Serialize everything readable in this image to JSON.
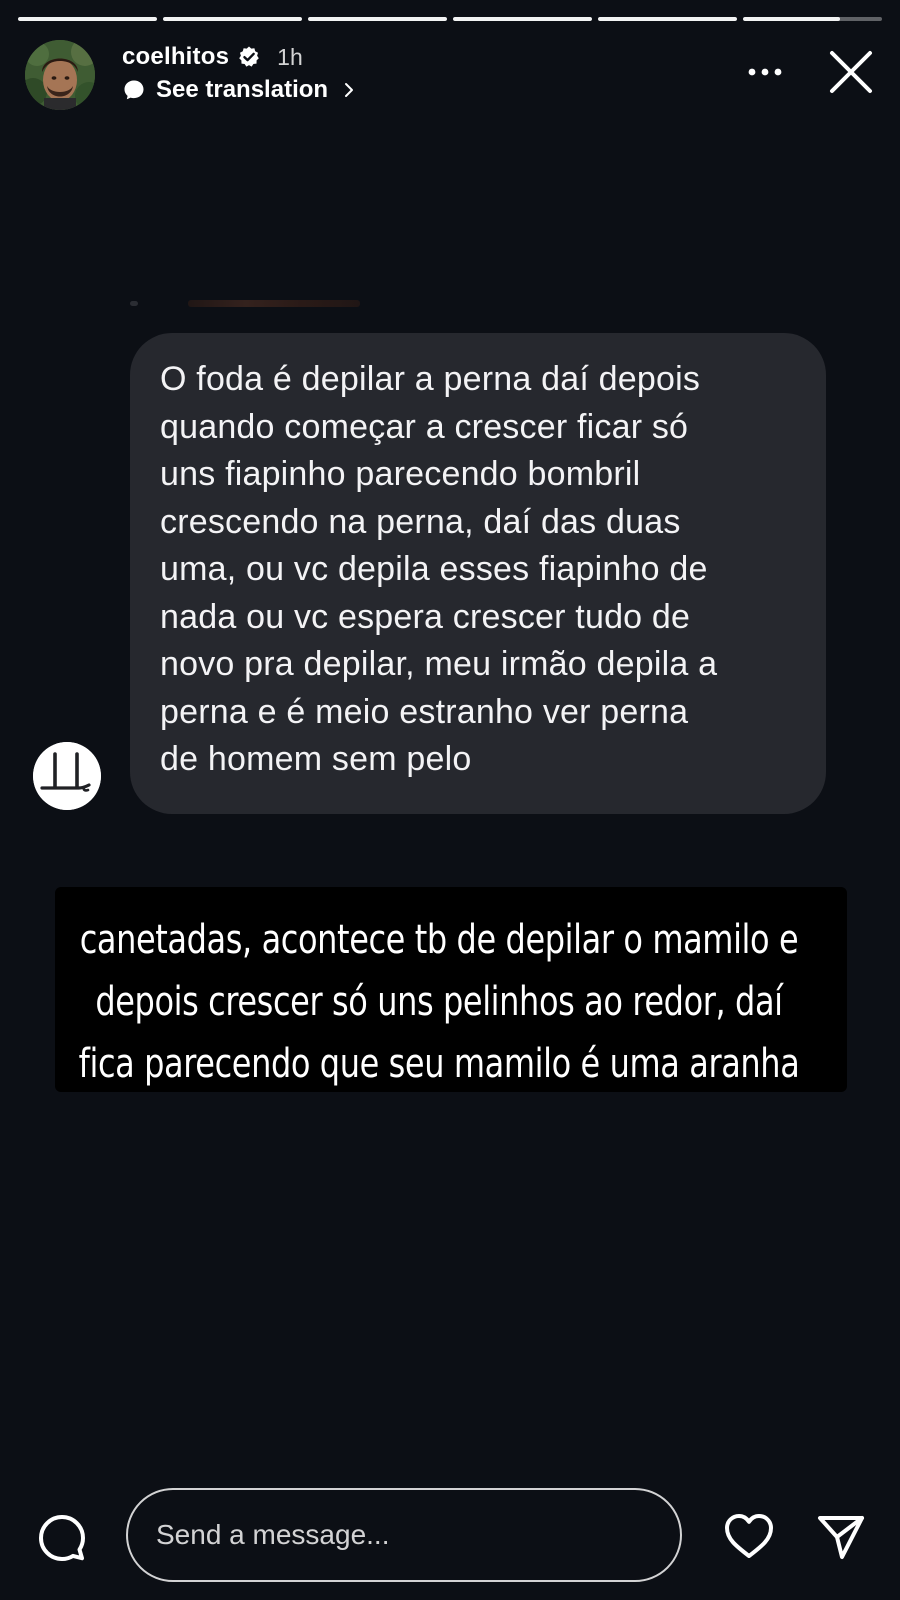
{
  "story": {
    "progress_segments": [
      1,
      1,
      1,
      1,
      1,
      0.7
    ]
  },
  "header": {
    "avatar_icon": "profile-avatar",
    "username": "coelhitos",
    "verified_icon": "verified-badge-icon",
    "time_ago": "1h",
    "translate_label": "See translation",
    "more_icon": "more-horizontal-icon",
    "close_icon": "close-icon"
  },
  "message": {
    "sender_avatar_icon": "message-sender-avatar",
    "text": "O foda é depilar a perna daí depois\nquando começar a crescer ficar só\nuns fiapinho parecendo bombril\ncrescendo na perna, daí das duas\numa, ou vc depila esses fiapinho de\nnada ou vc espera crescer tudo de\nnovo pra depilar, meu irmão depila a\nperna e é meio estranho ver perna\nde homem sem pelo"
  },
  "caption": {
    "lines": [
      "canetadas, acontece tb de depilar o mamilo e",
      "depois crescer só uns pelinhos ao redor, daí",
      "fica parecendo que seu mamilo é uma aranha"
    ]
  },
  "footer": {
    "camera_icon": "camera-icon",
    "message_placeholder": "Send a message...",
    "like_icon": "heart-icon",
    "send_icon": "send-icon"
  },
  "colors": {
    "background": "#0c0f15",
    "bubble": "#26282e",
    "caption_bg": "#000000",
    "text": "#ffffff"
  }
}
